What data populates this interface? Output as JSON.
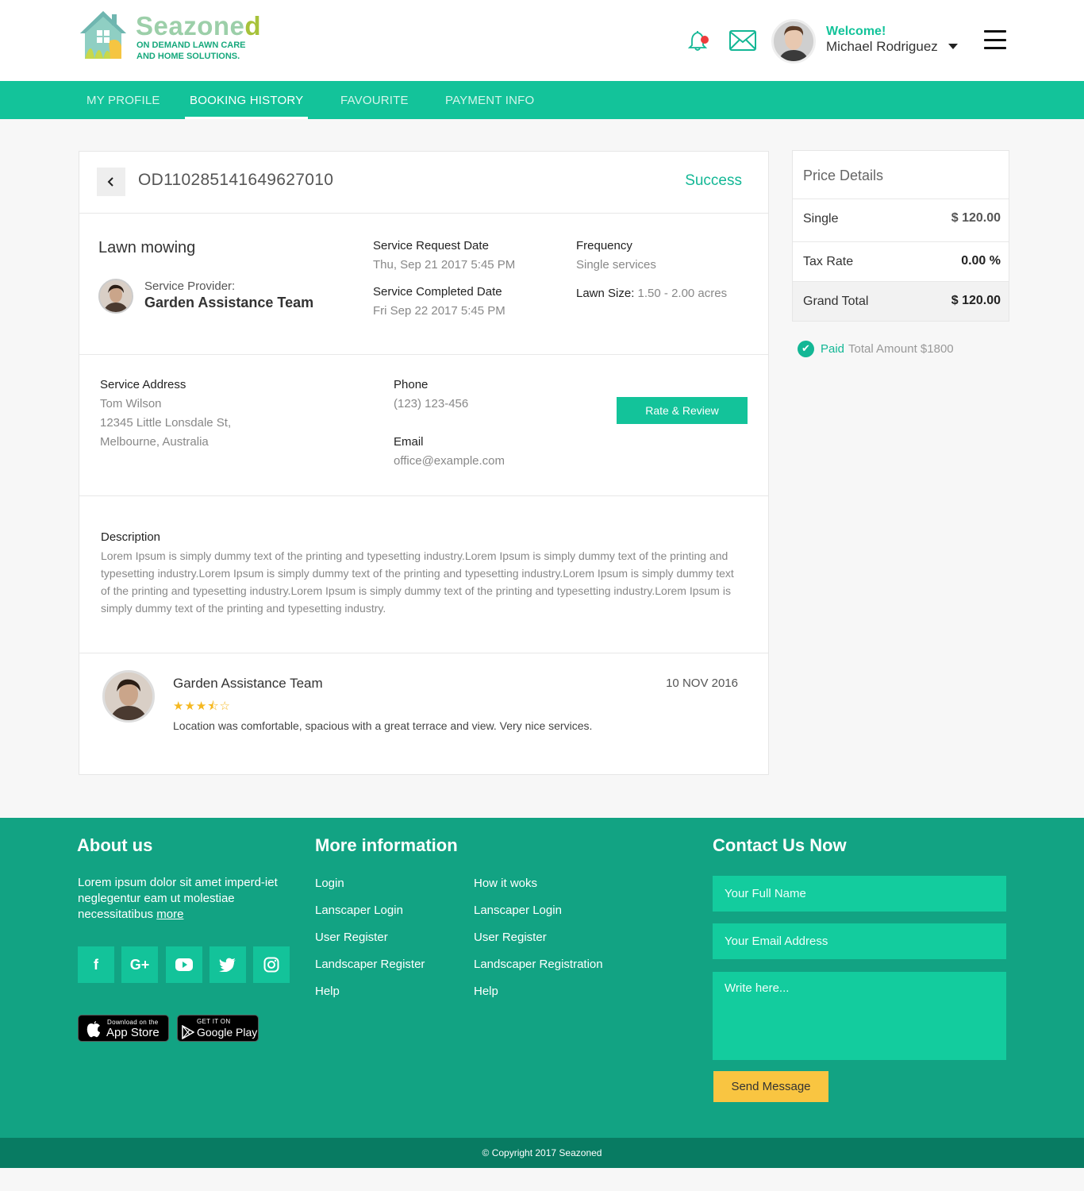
{
  "brand": {
    "name_part1": "Seazone",
    "name_part2": "d",
    "tagline_line1": "ON DEMAND LAWN CARE",
    "tagline_line2": "AND HOME SOLUTIONS."
  },
  "header": {
    "welcome": "Welcome!",
    "username": "Michael Rodriguez"
  },
  "nav": {
    "tabs": [
      "MY PROFILE",
      "BOOKING HISTORY",
      "FAVOURITE",
      "PAYMENT INFO"
    ],
    "active": "BOOKING HISTORY"
  },
  "order": {
    "id": "OD110285141649627010",
    "status": "Success",
    "service": "Lawn mowing",
    "provider_label": "Service Provider:",
    "provider_name": "Garden Assistance Team",
    "request_date_label": "Service Request Date",
    "request_date": "Thu, Sep 21 2017 5:45 PM",
    "completed_date_label": "Service Completed Date",
    "completed_date": "Fri Sep 22 2017 5:45 PM",
    "frequency_label": "Frequency",
    "frequency": "Single services",
    "lawn_size_label": "Lawn Size:",
    "lawn_size": "1.50 - 2.00 acres",
    "address_label": "Service Address",
    "address_name": "Tom Wilson",
    "address_line1": "12345 Little Lonsdale St,",
    "address_line2": "Melbourne, Australia",
    "phone_label": "Phone",
    "phone": "(123) 123-456",
    "email_label": "Email",
    "email": "office@example.com",
    "rate_button": "Rate & Review",
    "description_label": "Description",
    "description": "Lorem Ipsum is simply dummy text of the printing and typesetting industry.Lorem Ipsum is simply dummy text of the printing and typesetting industry.Lorem Ipsum is simply dummy text of the printing and typesetting industry.Lorem Ipsum is simply dummy text of the printing and typesetting industry.Lorem Ipsum is simply dummy text of the printing and typesetting industry.Lorem Ipsum is simply dummy text of the printing and typesetting industry."
  },
  "review": {
    "name": "Garden Assistance Team",
    "date": "10 NOV 2016",
    "stars": "★★★⯪☆",
    "rating": 3.5,
    "text": "Location was comfortable, spacious with a great terrace and view. Very nice services."
  },
  "price": {
    "title": "Price Details",
    "rows": [
      {
        "label": "Single",
        "value": "$ 120.00"
      },
      {
        "label": "Tax Rate",
        "value": "0.00 %"
      },
      {
        "label": "Grand Total",
        "value": "$ 120.00"
      }
    ],
    "paid_word": "Paid",
    "paid_total": "Total Amount $1800"
  },
  "footer": {
    "about_title": "About us",
    "about_text": "Lorem ipsum dolor sit amet imperd-iet neglegentur eam ut molestiae necessitatibus",
    "more": "more",
    "social_icons": [
      "facebook-icon",
      "google-plus-icon",
      "youtube-icon",
      "twitter-icon",
      "instagram-icon"
    ],
    "appstore_small": "Download on the",
    "appstore_big": "App Store",
    "gplay_small": "GET IT ON",
    "gplay_big": "Google Play",
    "more_info_title": "More information",
    "links_col1": [
      "Login",
      "Lanscaper Login",
      "User Register",
      "Landscaper Register",
      "Help"
    ],
    "links_col2": [
      "How it woks",
      "Lanscaper Login",
      "User Register",
      "Landscaper Registration",
      "Help"
    ],
    "contact_title": "Contact Us Now",
    "name_placeholder": "Your Full Name",
    "email_placeholder": "Your Email Address",
    "message_placeholder": "Write here...",
    "send": "Send Message",
    "copyright": "© Copyright 2017 Seazoned"
  },
  "colors": {
    "primary": "#13c39a",
    "footer": "#12a383",
    "copyright_bar": "#087b62",
    "accent_button": "#f9c541",
    "star": "#f5b820"
  }
}
